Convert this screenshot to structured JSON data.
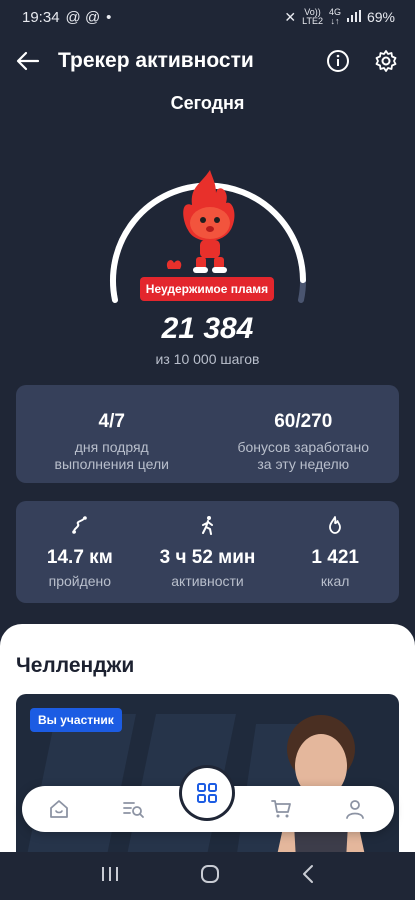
{
  "status_bar": {
    "time": "19:34",
    "indicators": "@ @",
    "net_label_top": "Vo))",
    "net_label_bottom": "LTE2",
    "net2_top": "4G",
    "net2_bottom": "↓↑",
    "battery": "69%"
  },
  "header": {
    "title": "Трекер активности"
  },
  "today_label": "Сегодня",
  "progress": {
    "fraction": 1.0,
    "mascot_badge": "Неудержимое пламя",
    "steps": "21 384",
    "goal": "из 10 000 шагов"
  },
  "streak_card": {
    "days_value": "4/7",
    "days_label_1": "дня подряд",
    "days_label_2": "выполнения цели",
    "bonus_value": "60/270",
    "bonus_label_1": "бонусов заработано",
    "bonus_label_2": "за эту неделю"
  },
  "stats_card": {
    "distance_value": "14.7 км",
    "distance_label": "пройдено",
    "time_value": "3 ч 52 мин",
    "time_label": "активности",
    "calories_value": "1 421",
    "calories_label": "ккал"
  },
  "challenges": {
    "title": "Челленджи",
    "banner_tag": "Вы участник"
  },
  "colors": {
    "background": "#1f2636",
    "card": "#36405a",
    "accent_red": "#e3262d",
    "tag_blue": "#1c5ce3"
  },
  "icons": [
    "back-arrow-icon",
    "info-icon",
    "gear-icon",
    "route-icon",
    "walk-icon",
    "flame-icon",
    "home-icon",
    "catalog-search-icon",
    "grid-icon",
    "cart-icon",
    "profile-icon"
  ]
}
